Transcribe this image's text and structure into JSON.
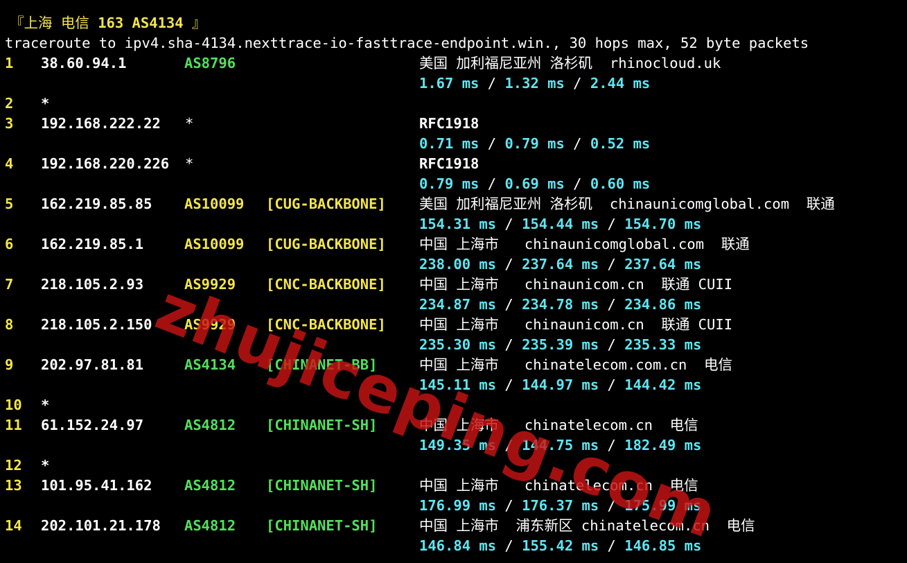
{
  "header": {
    "bracket_open": "『",
    "location": "上海 电信",
    "target": "163 AS4134",
    "bracket_close": "』"
  },
  "command_line": "traceroute to ipv4.sha-4134.nexttrace-io-fasttrace-endpoint.win., 30 hops max, 52 byte packets",
  "hops": [
    {
      "hop": "1",
      "ip": "38.60.94.1",
      "asn": "AS8796",
      "tag": "",
      "geo": "美国 加利福尼亚州 洛杉矶  rhinocloud.uk",
      "rtt": [
        "1.67 ms",
        "1.32 ms",
        "2.44 ms"
      ]
    },
    {
      "hop": "2",
      "star": "*"
    },
    {
      "hop": "3",
      "ip": "192.168.222.22",
      "asn_star": "*",
      "geo": "RFC1918",
      "rtt": [
        "0.71 ms",
        "0.79 ms",
        "0.52 ms"
      ]
    },
    {
      "hop": "4",
      "ip": "192.168.220.226",
      "asn_star": "*",
      "geo": "RFC1918",
      "rtt": [
        "0.79 ms",
        "0.69 ms",
        "0.60 ms"
      ]
    },
    {
      "hop": "5",
      "ip": "162.219.85.85",
      "asn": "AS10099",
      "tag": "[CUG-BACKBONE]",
      "geo": "美国 加利福尼亚州 洛杉矶  chinaunicomglobal.com  联通",
      "rtt": [
        "154.31 ms",
        "154.44 ms",
        "154.70 ms"
      ]
    },
    {
      "hop": "6",
      "ip": "162.219.85.1",
      "asn": "AS10099",
      "tag": "[CUG-BACKBONE]",
      "geo": "中国 上海市   chinaunicomglobal.com  联通",
      "rtt": [
        "238.00 ms",
        "237.64 ms",
        "237.64 ms"
      ]
    },
    {
      "hop": "7",
      "ip": "218.105.2.93",
      "asn": "AS9929",
      "tag": "[CNC-BACKBONE]",
      "geo": "中国 上海市   chinaunicom.cn  联通 CUII",
      "rtt": [
        "234.87 ms",
        "234.78 ms",
        "234.86 ms"
      ]
    },
    {
      "hop": "8",
      "ip": "218.105.2.150",
      "asn": "AS9929",
      "tag": "[CNC-BACKBONE]",
      "geo": "中国 上海市   chinaunicom.cn  联通 CUII",
      "rtt": [
        "235.30 ms",
        "235.39 ms",
        "235.33 ms"
      ]
    },
    {
      "hop": "9",
      "ip": "202.97.81.81",
      "asn": "AS4134",
      "tag": "[CHINANET-BB]",
      "geo": "中国 上海市   chinatelecom.com.cn  电信",
      "rtt": [
        "145.11 ms",
        "144.97 ms",
        "144.42 ms"
      ]
    },
    {
      "hop": "10",
      "star": "*"
    },
    {
      "hop": "11",
      "ip": "61.152.24.97",
      "asn": "AS4812",
      "tag": "[CHINANET-SH]",
      "geo": "中国 上海市   chinatelecom.cn  电信",
      "rtt": [
        "149.35 ms",
        "144.75 ms",
        "182.49 ms"
      ]
    },
    {
      "hop": "12",
      "star": "*"
    },
    {
      "hop": "13",
      "ip": "101.95.41.162",
      "asn": "AS4812",
      "tag": "[CHINANET-SH]",
      "geo": "中国 上海市   chinatelecom.cn  电信",
      "rtt": [
        "176.99 ms",
        "176.37 ms",
        "175.99 ms"
      ]
    },
    {
      "hop": "14",
      "ip": "202.101.21.178",
      "asn": "AS4812",
      "tag": "[CHINANET-SH]",
      "geo": "中国 上海市  浦东新区 chinatelecom.cn  电信",
      "rtt": [
        "146.84 ms",
        "155.42 ms",
        "146.85 ms"
      ]
    }
  ],
  "rtt_separator": "/",
  "watermark": "zhujiceping.com",
  "colors": {
    "background": "#000000",
    "hop_number": "#f3e64a",
    "asn_green": "#52e05c",
    "asn_yellow": "#f3e64a",
    "rtt": "#5ee6f2",
    "watermark": "#c81414"
  }
}
